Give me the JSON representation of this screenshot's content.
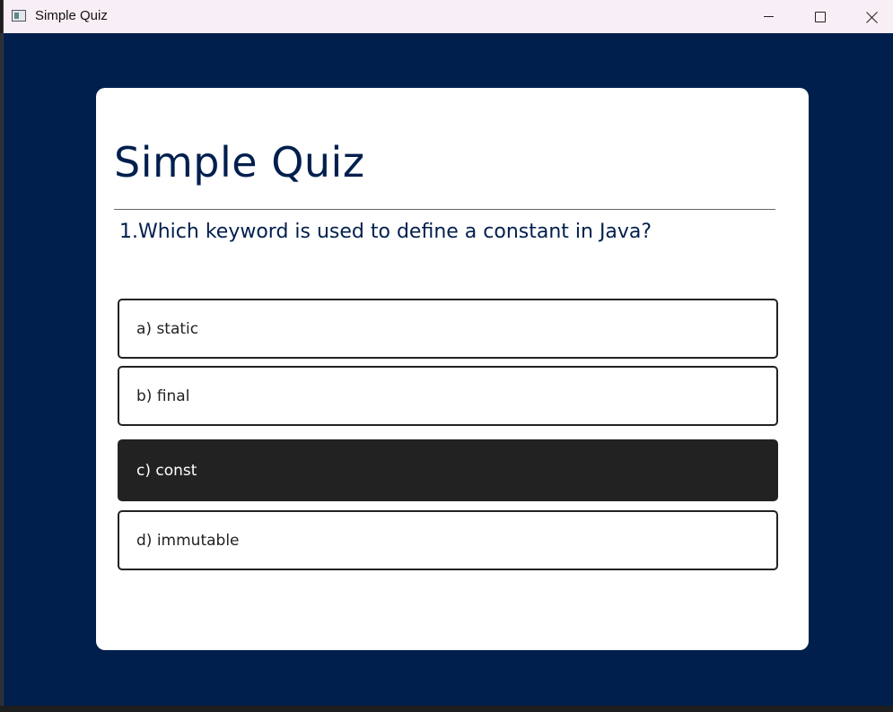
{
  "window": {
    "title": "Simple Quiz",
    "background_color": "#001f4d",
    "icons": {
      "app": "app-window-icon",
      "minimize": "minimize-icon",
      "maximize": "maximize-icon",
      "close": "close-icon"
    }
  },
  "quiz": {
    "title": "Simple Quiz",
    "question": "1.Which keyword is used to define a constant in Java?",
    "options": [
      {
        "label": "a) static",
        "selected": false
      },
      {
        "label": "b) final",
        "selected": false
      },
      {
        "label": "c) const",
        "selected": true
      },
      {
        "label": "d) immutable",
        "selected": false
      }
    ]
  },
  "colors": {
    "accent": "#001f4d",
    "selected_option": "#222222",
    "card": "#ffffff"
  }
}
